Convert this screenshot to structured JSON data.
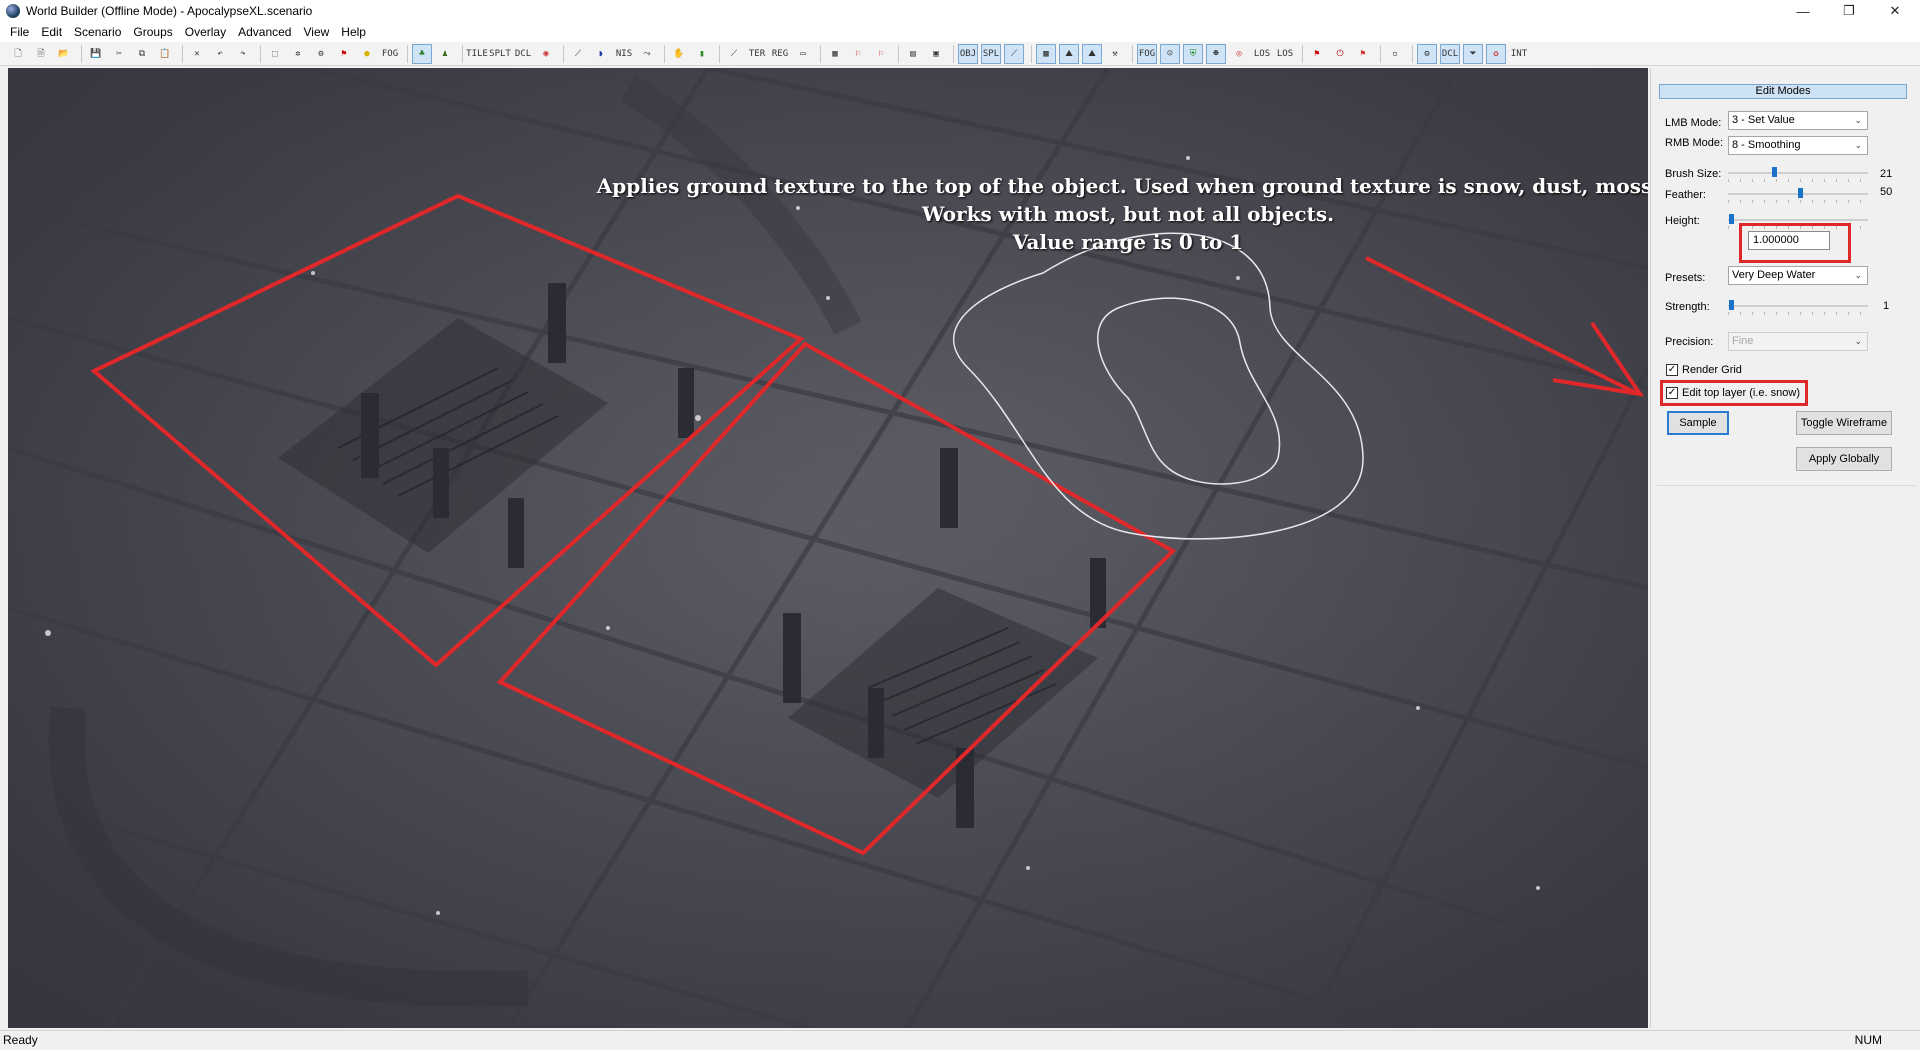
{
  "window": {
    "title": "World Builder (Offline Mode) - ApocalypseXL.scenario",
    "minimize": "—",
    "restore": "❐",
    "close": "✕"
  },
  "menu": [
    "File",
    "Edit",
    "Scenario",
    "Groups",
    "Overlay",
    "Advanced",
    "View",
    "Help"
  ],
  "toolbar": {
    "fog_label": "FOG",
    "tile_label": "TILE",
    "splt_label": "SPLT",
    "dcl_label": "DCL",
    "nis_label": "NIS",
    "ter_label": "TER",
    "reg_label": "REG",
    "obj_label": "OBJ",
    "spl_label": "SPL",
    "fog2_label": "FOG",
    "los_label": "LOS",
    "los2_label": "LOS",
    "dcl2_label": "DCL",
    "int_label": "INT"
  },
  "viewport": {
    "tooltip_lines": [
      "Applies ground texture to the top of the object. Used when ground texture is snow, dust, moss.",
      "Works with most, but not all objects.",
      "Value range is 0 to 1"
    ],
    "annotation_color": "#e0282a"
  },
  "panel": {
    "header": "Edit Modes",
    "lmb_label": "LMB Mode:",
    "lmb_value": "3 - Set Value",
    "rmb_label": "RMB Mode:",
    "rmb_value": "8 - Smoothing",
    "brush_label": "Brush Size:",
    "brush_value": "21",
    "feather_label": "Feather:",
    "feather_value": "50",
    "height_label": "Height:",
    "height_value": "1.000000",
    "presets_label": "Presets:",
    "presets_value": "Very Deep Water",
    "strength_label": "Strength:",
    "strength_value": "1",
    "precision_label": "Precision:",
    "precision_value": "Fine",
    "render_grid_label": "Render Grid",
    "render_grid_checked": "✓",
    "edit_top_label": "Edit top layer (i.e. snow)",
    "edit_top_checked": "✓",
    "sample_button": "Sample",
    "toggle_wireframe_button": "Toggle Wireframe",
    "apply_globally_button": "Apply Globally"
  },
  "status": {
    "left": "Ready",
    "right": "NUM"
  }
}
